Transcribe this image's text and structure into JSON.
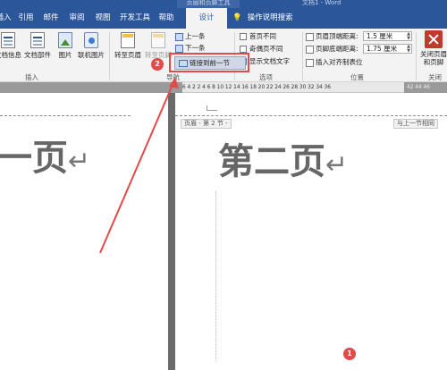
{
  "title": {
    "context_tab": "页眉和页脚工具",
    "document": "文档1 - Word"
  },
  "tabs": [
    {
      "label": "插入"
    },
    {
      "label": "引用"
    },
    {
      "label": "邮件"
    },
    {
      "label": "审阅"
    },
    {
      "label": "视图"
    },
    {
      "label": "开发工具"
    },
    {
      "label": "帮助"
    },
    {
      "label": "设计"
    }
  ],
  "tell_me": "操作说明搜索",
  "ribbon": {
    "insert_group": {
      "label": "插入",
      "buttons": [
        "文档信息",
        "文档部件",
        "图片",
        "联机图片"
      ]
    },
    "nav_group": {
      "label": "导航",
      "goto_header": "转至页眉",
      "goto_footer": "转至页脚",
      "previous": "上一条",
      "next": "下一条",
      "link_previous": "链接到前一节"
    },
    "options_group": {
      "label": "选项",
      "diff_first": "首页不同",
      "diff_odd_even": "奇偶页不同",
      "show_text": "显示文档文字"
    },
    "position_group": {
      "label": "位置",
      "header_dist_label": "页眉顶端距离:",
      "header_dist_value": "1.5 厘米",
      "footer_dist_label": "页脚底端距离:",
      "footer_dist_value": "1.75 厘米",
      "insert_align_tab": "插入对齐制表位"
    },
    "close_group": {
      "label": "关闭",
      "close_button": "关闭页眉和页脚"
    }
  },
  "ruler": {
    "left_numbers": "6  4  2     2  4  6  8  10  12  14  16  18  20  22  24  26  28  30  32  34  36",
    "right_numbers": "42  44  46"
  },
  "document": {
    "left_page_text": "一页",
    "right_page_text": "第二页",
    "return_mark": "↵",
    "header_tag": "页眉 - 第 2 节 -",
    "same_as_previous": "与上一节相同"
  },
  "annotations": {
    "step1": "1",
    "step2": "2"
  },
  "colors": {
    "ribbon_blue": "#2b579a",
    "highlight_red": "#e34b4b"
  }
}
